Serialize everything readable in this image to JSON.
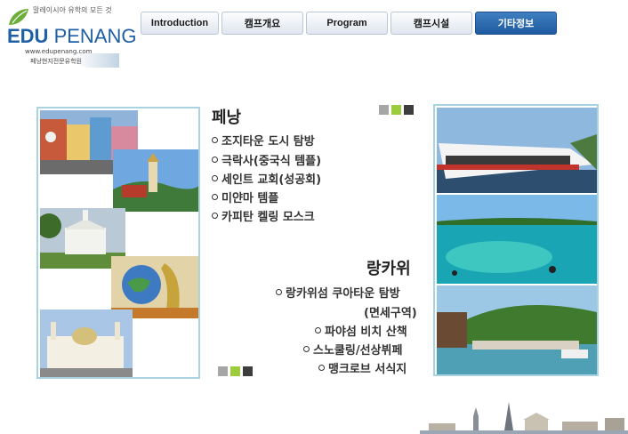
{
  "logo": {
    "tagline": "말레이시아 유학의 모든 것",
    "brand_left": "EDU",
    "brand_right": "PENANG",
    "url": "www.edupenang.com",
    "subtitle": "페낭현지전문유학원"
  },
  "nav": {
    "tabs": [
      {
        "label": "Introduction"
      },
      {
        "label": "캠프개요"
      },
      {
        "label": "Program"
      },
      {
        "label": "캠프시설"
      },
      {
        "label": "기타정보"
      }
    ]
  },
  "penang": {
    "title": "페낭",
    "items": [
      "조지타운 도시 탐방",
      "극락사(중국식 템플)",
      "세인트 교회(성공회)",
      "미얀마 템플",
      "카피탄 켈링 모스크"
    ]
  },
  "langkawi": {
    "title": "랑카위",
    "items": [
      "랑카위섬 쿠아타운 탐방",
      "(면세구역)",
      "파야섬 비치 산책",
      "스노쿨링/선상뷔페",
      "맹크로브 서식지"
    ]
  },
  "colors": {
    "square_gray": "#a6a6a6",
    "square_green": "#9ccc3c",
    "square_dark": "#3d3d3d",
    "frame_border": "#a9d3e0",
    "active_tab": "#2a6aad"
  },
  "icons": {
    "logo_leaf": "leaf-icon",
    "bullet": "circle-bullet-icon"
  }
}
